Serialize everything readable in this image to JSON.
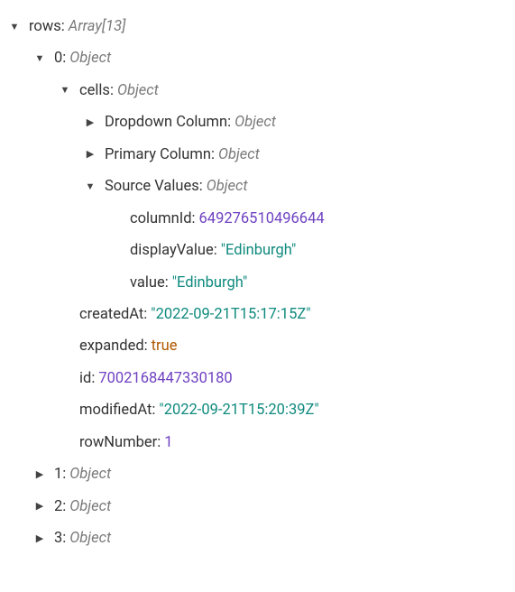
{
  "glyphs": {
    "expanded": "▼",
    "collapsed": "▶"
  },
  "root": {
    "key": "rows",
    "type_label": "Array[13]"
  },
  "row0": {
    "key": "0",
    "type_label": "Object",
    "cells": {
      "key": "cells",
      "type_label": "Object",
      "dropdown": {
        "key": "Dropdown Column",
        "type_label": "Object"
      },
      "primary": {
        "key": "Primary Column",
        "type_label": "Object"
      },
      "source": {
        "key": "Source Values",
        "type_label": "Object",
        "columnId": {
          "key": "columnId",
          "value": "649276510496644"
        },
        "displayValue": {
          "key": "displayValue",
          "value": "\"Edinburgh\""
        },
        "value": {
          "key": "value",
          "value": "\"Edinburgh\""
        }
      }
    },
    "createdAt": {
      "key": "createdAt",
      "value": "\"2022-09-21T15:17:15Z\""
    },
    "expanded": {
      "key": "expanded",
      "value": "true"
    },
    "id": {
      "key": "id",
      "value": "7002168447330180"
    },
    "modifiedAt": {
      "key": "modifiedAt",
      "value": "\"2022-09-21T15:20:39Z\""
    },
    "rowNumber": {
      "key": "rowNumber",
      "value": "1"
    }
  },
  "row1": {
    "key": "1",
    "type_label": "Object"
  },
  "row2": {
    "key": "2",
    "type_label": "Object"
  },
  "row3": {
    "key": "3",
    "type_label": "Object"
  }
}
